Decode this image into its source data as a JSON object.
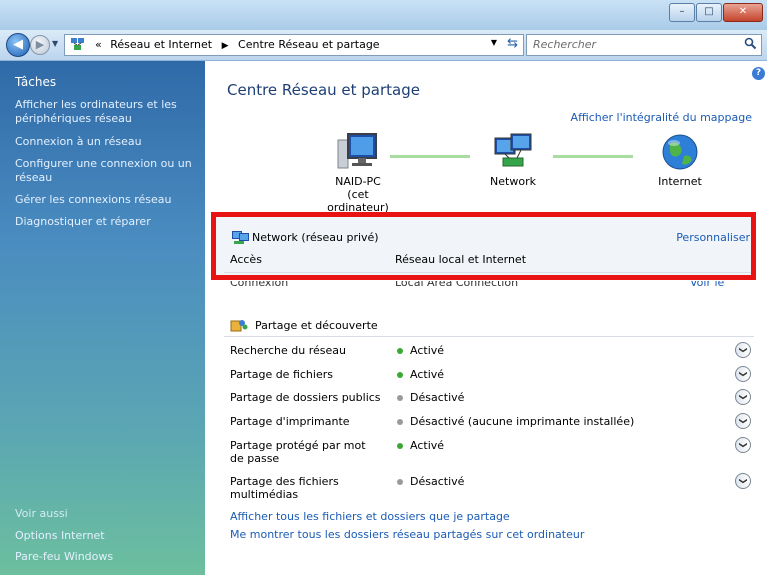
{
  "window": {
    "minimize": "–",
    "maximize": "□",
    "close": "✕"
  },
  "nav": {
    "back_glyph": "◀",
    "forward_glyph": "▶",
    "breadcrumb_prefix": "«",
    "breadcrumbs": [
      "Réseau et Internet",
      "Centre Réseau et partage"
    ],
    "search_placeholder": "Rechercher"
  },
  "sidebar": {
    "tasks_heading": "Tâches",
    "tasks": [
      "Afficher les ordinateurs et les périphériques réseau",
      "Connexion à un réseau",
      "Configurer une connexion ou un réseau",
      "Gérer les connexions réseau",
      "Diagnostiquer et réparer"
    ],
    "see_also_heading": "Voir aussi",
    "see_also": [
      "Options Internet",
      "Pare-feu Windows"
    ]
  },
  "main": {
    "title": "Centre Réseau et partage",
    "full_map_link": "Afficher l'intégralité du mappage",
    "map": {
      "computer_line1": "NAID-PC",
      "computer_line2": "(cet ordinateur)",
      "network": "Network",
      "internet": "Internet"
    },
    "network": {
      "name": "Network (réseau privé)",
      "customize": "Personnaliser",
      "access_label": "Accès",
      "access_value": "Réseau local et Internet",
      "connection_label": "Connexion",
      "connection_value": "Local Area Connection",
      "connection_action": "Voir le statut"
    },
    "sharing": {
      "heading": "Partage et découverte",
      "rows": [
        {
          "label": "Recherche du réseau",
          "value": "Activé",
          "status": "on"
        },
        {
          "label": "Partage de fichiers",
          "value": "Activé",
          "status": "on"
        },
        {
          "label": "Partage de dossiers publics",
          "value": "Désactivé",
          "status": "off"
        },
        {
          "label": "Partage d'imprimante",
          "value": "Désactivé (aucune imprimante installée)",
          "status": "off"
        },
        {
          "label": "Partage protégé par mot de passe",
          "value": "Activé",
          "status": "on"
        },
        {
          "label": "Partage des fichiers multimédias",
          "value": "Désactivé",
          "status": "off"
        }
      ]
    },
    "bottom_links": [
      "Afficher tous les fichiers et dossiers que je partage",
      "Me montrer tous les dossiers réseau partagés sur cet ordinateur"
    ]
  },
  "colors": {
    "status_on": "#3aa832",
    "status_off": "#9a9a9a",
    "highlight": "#e81414",
    "link": "#1a5bb5"
  },
  "icons": [
    "back-icon",
    "forward-icon",
    "network-center-icon",
    "refresh-icon",
    "search-icon",
    "help-icon",
    "computer-icon",
    "network-icon",
    "globe-icon",
    "network-status-icon",
    "sharing-icon",
    "chevron-down-icon"
  ]
}
